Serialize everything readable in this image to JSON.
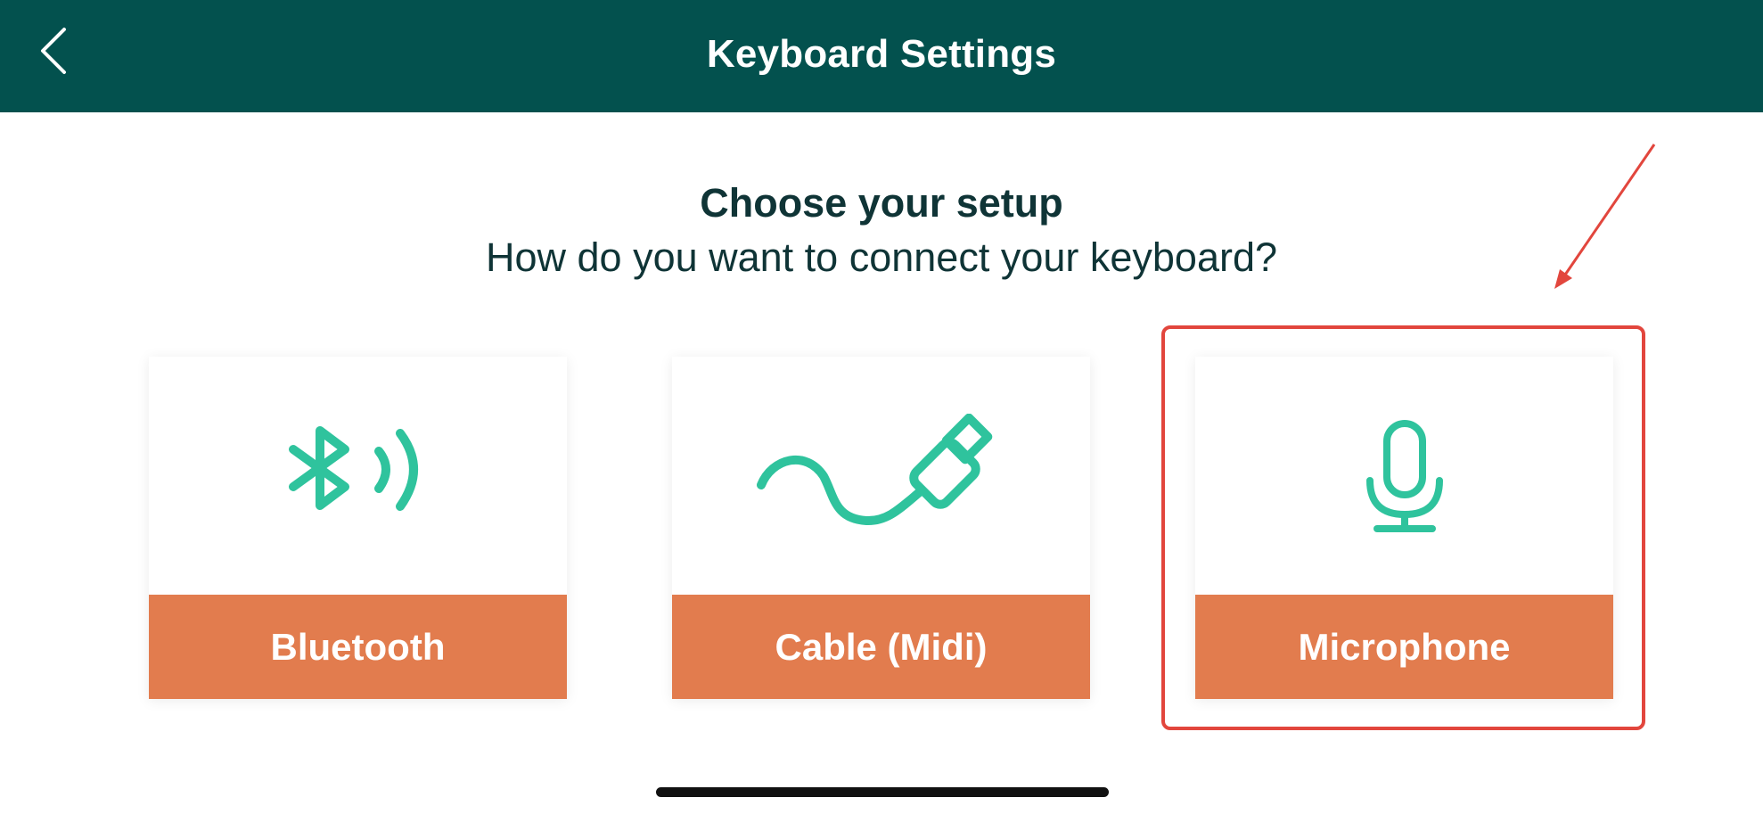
{
  "header": {
    "title": "Keyboard Settings",
    "back_icon": "chevron-left-icon",
    "background_color": "#03514e"
  },
  "setup": {
    "heading": "Choose your setup",
    "subheading": "How do you want to connect your keyboard?"
  },
  "options": [
    {
      "label": "Bluetooth",
      "icon": "bluetooth-icon"
    },
    {
      "label": "Cable (Midi)",
      "icon": "usb-cable-icon"
    },
    {
      "label": "Microphone",
      "icon": "microphone-icon"
    }
  ],
  "colors": {
    "accent_orange": "#e27c4e",
    "icon_teal": "#2fc39d",
    "annotation_red": "#e2463d",
    "text_dark": "#0f3436"
  },
  "annotation": {
    "highlighted_option": "Microphone"
  }
}
